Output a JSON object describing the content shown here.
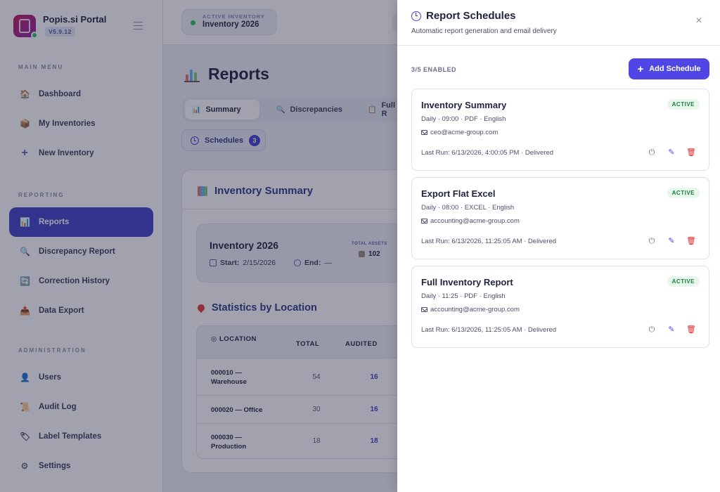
{
  "app": {
    "name": "Popis.si Portal",
    "version": "V5.9.12"
  },
  "sidebar": {
    "sections": [
      {
        "title": "MAIN MENU",
        "items": [
          {
            "label": "Dashboard",
            "icon": "house-icon"
          },
          {
            "label": "My Inventories",
            "icon": "box-icon"
          },
          {
            "label": "New Inventory",
            "icon": "plus-icon"
          }
        ]
      },
      {
        "title": "REPORTING",
        "items": [
          {
            "label": "Reports",
            "icon": "bar-chart-icon",
            "active": true
          },
          {
            "label": "Discrepancy Report",
            "icon": "magnifier-icon"
          },
          {
            "label": "Correction History",
            "icon": "refresh-icon"
          },
          {
            "label": "Data Export",
            "icon": "export-icon"
          }
        ]
      },
      {
        "title": "ADMINISTRATION",
        "items": [
          {
            "label": "Users",
            "icon": "user-icon"
          },
          {
            "label": "Audit Log",
            "icon": "scroll-icon"
          },
          {
            "label": "Label Templates",
            "icon": "tag-icon"
          },
          {
            "label": "Settings",
            "icon": "gear-icon"
          }
        ]
      }
    ]
  },
  "topbar": {
    "inventory_label": "ACTIVE INVENTORY",
    "inventory_name": "Inventory 2026"
  },
  "page": {
    "title": "Reports",
    "tabs": [
      {
        "label": "Summary",
        "active": true
      },
      {
        "label": "Discrepancies"
      },
      {
        "label": "Full R"
      }
    ],
    "schedules_button": {
      "label": "Schedules",
      "count": "3"
    },
    "summary_card": {
      "title": "Inventory Summary",
      "inventory": {
        "name": "Inventory 2026",
        "start_label": "Start:",
        "start_value": "2/15/2026",
        "end_label": "End:",
        "end_value": "—",
        "total_assets_label": "TOTAL ASSETS",
        "total_assets_value": "102"
      },
      "location_title": "Statistics by Location",
      "columns": [
        "LOCATION",
        "TOTAL",
        "AUDITED"
      ],
      "rows": [
        {
          "location": "000010 — Warehouse",
          "total": "54",
          "audited": "16"
        },
        {
          "location": "000020 — Office",
          "total": "30",
          "audited": "16"
        },
        {
          "location": "000030 — Production",
          "total": "18",
          "audited": "18"
        }
      ]
    }
  },
  "drawer": {
    "title": "Report Schedules",
    "subtitle": "Automatic report generation and email delivery",
    "enabled_text": "3/5 ENABLED",
    "add_button": "Add Schedule",
    "schedules": [
      {
        "name": "Inventory Summary",
        "status": "ACTIVE",
        "meta": "Daily · 09:00 · PDF · English",
        "email": "ceo@acme-group.com",
        "last_run": "Last Run: 6/13/2026, 4:00:05 PM · Delivered"
      },
      {
        "name": "Export Flat Excel",
        "status": "ACTIVE",
        "meta": "Daily · 08:00 · EXCEL · English",
        "email": "accounting@acme-group.com",
        "last_run": "Last Run: 6/13/2026, 11:25:05 AM · Delivered"
      },
      {
        "name": "Full Inventory Report",
        "status": "ACTIVE",
        "meta": "Daily · 11:25 · PDF · English",
        "email": "accounting@acme-group.com",
        "last_run": "Last Run: 6/13/2026, 11:25:05 AM · Delivered"
      }
    ]
  },
  "colors": {
    "accent": "#3f40c9",
    "button": "#4f46e5",
    "active_badge_bg": "#e8f7ec",
    "active_badge_text": "#15803d",
    "danger": "#dc2626"
  }
}
